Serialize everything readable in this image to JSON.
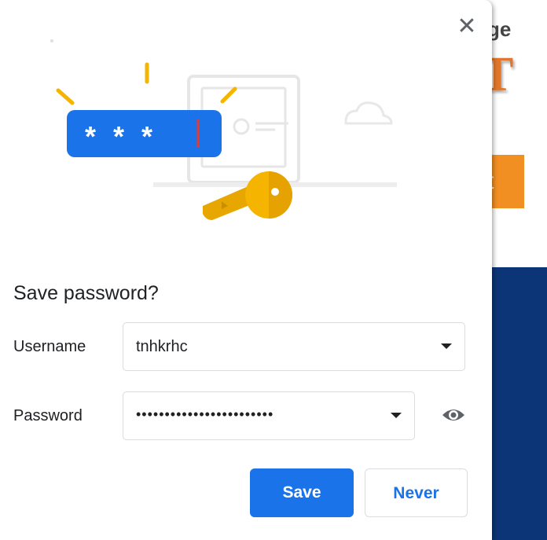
{
  "background": {
    "partial_text": "ge",
    "logo_fragment": "T",
    "button_fragment": "t"
  },
  "dialog": {
    "close_glyph": "✕",
    "title": "Save password?",
    "illustration": {
      "password_mask": "* * *"
    },
    "username": {
      "label": "Username",
      "value": "tnhkrhc"
    },
    "password": {
      "label": "Password",
      "value": "••••••••••••••••••••••••"
    },
    "buttons": {
      "save": "Save",
      "never": "Never"
    }
  },
  "colors": {
    "accent": "#1a73e8",
    "key": "#f4b400",
    "bg_button": "#f28f23",
    "bg_band": "#0b3576"
  }
}
